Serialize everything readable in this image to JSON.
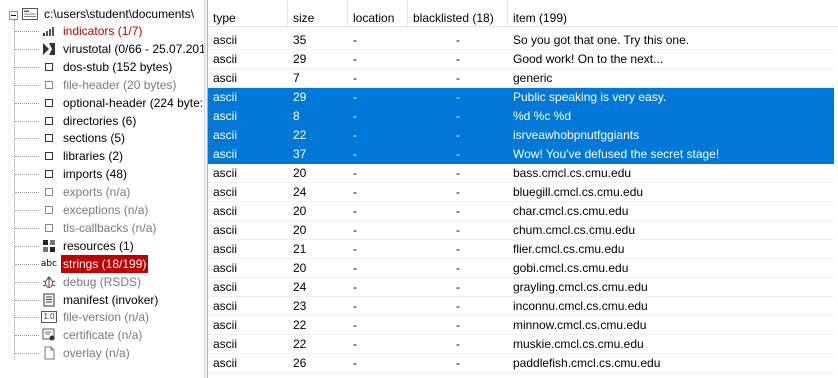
{
  "tree": {
    "root_label": "c:\\users\\student\\documents\\",
    "items": [
      {
        "label": "indicators (1/7)",
        "style": "red",
        "icon": "bar-chart-icon"
      },
      {
        "label": "virustotal (0/66 - 25.07.201",
        "style": "normal",
        "icon": "virustotal-icon"
      },
      {
        "label": "dos-stub (152 bytes)",
        "style": "normal",
        "icon": "square-icon"
      },
      {
        "label": "file-header (20 bytes)",
        "style": "grey",
        "icon": "square-icon"
      },
      {
        "label": "optional-header (224 byte:",
        "style": "normal",
        "icon": "square-icon"
      },
      {
        "label": "directories (6)",
        "style": "normal",
        "icon": "square-icon"
      },
      {
        "label": "sections (5)",
        "style": "normal",
        "icon": "square-icon"
      },
      {
        "label": "libraries (2)",
        "style": "normal",
        "icon": "square-icon"
      },
      {
        "label": "imports (48)",
        "style": "normal",
        "icon": "square-icon"
      },
      {
        "label": "exports (n/a)",
        "style": "grey",
        "icon": "square-icon"
      },
      {
        "label": "exceptions (n/a)",
        "style": "grey",
        "icon": "square-icon"
      },
      {
        "label": "tls-callbacks (n/a)",
        "style": "grey",
        "icon": "square-icon"
      },
      {
        "label": "resources (1)",
        "style": "normal",
        "icon": "resources-icon"
      },
      {
        "label": "strings (18/199)",
        "style": "sel",
        "icon": "abc-icon"
      },
      {
        "label": "debug (RSDS)",
        "style": "grey",
        "icon": "bug-icon"
      },
      {
        "label": "manifest (invoker)",
        "style": "normal",
        "icon": "manifest-icon"
      },
      {
        "label": "file-version (n/a)",
        "style": "grey",
        "icon": "version-icon"
      },
      {
        "label": "certificate (n/a)",
        "style": "grey",
        "icon": "certificate-icon"
      },
      {
        "label": "overlay (n/a)",
        "style": "grey",
        "icon": "document-icon"
      }
    ],
    "abc_text": "abc",
    "version_text": "1.0"
  },
  "table": {
    "headers": [
      "type",
      "size",
      "location",
      "blacklisted (18)",
      "item (199)"
    ],
    "rows": [
      {
        "type": "ascii",
        "size": "35",
        "location": "-",
        "blacklisted": "-",
        "item": "So you got that one.  Try this one.",
        "selected": false
      },
      {
        "type": "ascii",
        "size": "29",
        "location": "-",
        "blacklisted": "-",
        "item": "Good work!  On to the next...",
        "selected": false
      },
      {
        "type": "ascii",
        "size": "7",
        "location": "-",
        "blacklisted": "-",
        "item": "generic",
        "selected": false
      },
      {
        "type": "ascii",
        "size": "29",
        "location": "-",
        "blacklisted": "-",
        "item": "Public speaking is very easy.",
        "selected": true
      },
      {
        "type": "ascii",
        "size": "8",
        "location": "-",
        "blacklisted": "-",
        "item": "%d %c %d",
        "selected": true
      },
      {
        "type": "ascii",
        "size": "22",
        "location": "-",
        "blacklisted": "-",
        "item": "isrveawhobpnutfggiants",
        "selected": true
      },
      {
        "type": "ascii",
        "size": "37",
        "location": "-",
        "blacklisted": "-",
        "item": "Wow! You've defused the secret stage!",
        "selected": true
      },
      {
        "type": "ascii",
        "size": "20",
        "location": "-",
        "blacklisted": "-",
        "item": "bass.cmcl.cs.cmu.edu",
        "selected": false
      },
      {
        "type": "ascii",
        "size": "24",
        "location": "-",
        "blacklisted": "-",
        "item": "bluegill.cmcl.cs.cmu.edu",
        "selected": false
      },
      {
        "type": "ascii",
        "size": "20",
        "location": "-",
        "blacklisted": "-",
        "item": "char.cmcl.cs.cmu.edu",
        "selected": false
      },
      {
        "type": "ascii",
        "size": "20",
        "location": "-",
        "blacklisted": "-",
        "item": "chum.cmcl.cs.cmu.edu",
        "selected": false
      },
      {
        "type": "ascii",
        "size": "21",
        "location": "-",
        "blacklisted": "-",
        "item": "flier.cmcl.cs.cmu.edu",
        "selected": false
      },
      {
        "type": "ascii",
        "size": "20",
        "location": "-",
        "blacklisted": "-",
        "item": "gobi.cmcl.cs.cmu.edu",
        "selected": false
      },
      {
        "type": "ascii",
        "size": "24",
        "location": "-",
        "blacklisted": "-",
        "item": "grayling.cmcl.cs.cmu.edu",
        "selected": false
      },
      {
        "type": "ascii",
        "size": "23",
        "location": "-",
        "blacklisted": "-",
        "item": "inconnu.cmcl.cs.cmu.edu",
        "selected": false
      },
      {
        "type": "ascii",
        "size": "22",
        "location": "-",
        "blacklisted": "-",
        "item": "minnow.cmcl.cs.cmu.edu",
        "selected": false
      },
      {
        "type": "ascii",
        "size": "22",
        "location": "-",
        "blacklisted": "-",
        "item": "muskie.cmcl.cs.cmu.edu",
        "selected": false
      },
      {
        "type": "ascii",
        "size": "26",
        "location": "-",
        "blacklisted": "-",
        "item": "paddlefish.cmcl.cs.cmu.edu",
        "selected": false
      }
    ]
  },
  "colors": {
    "selection_blue": "#0078d7",
    "selected_node_red": "#c00000",
    "indicator_red": "#c00000",
    "disabled_grey": "#7a7a7a"
  }
}
